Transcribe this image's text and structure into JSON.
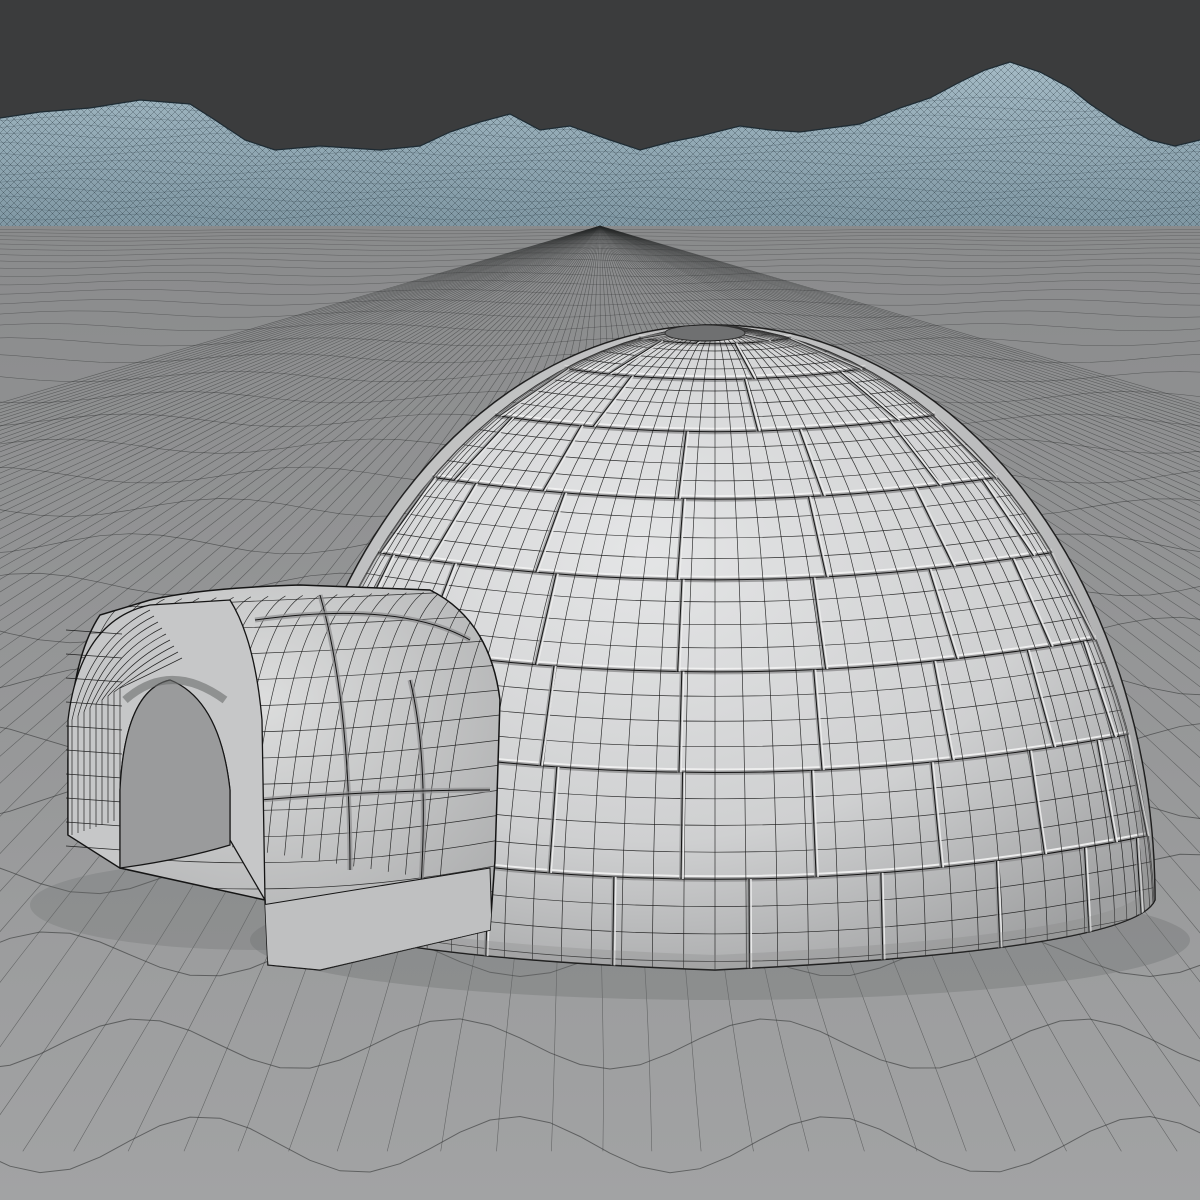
{
  "viewport": {
    "background_color": "#3b3c3d",
    "mode": "wireframe-on-shaded"
  },
  "scene": {
    "objects": [
      "mountains",
      "ground-plane",
      "igloo-dome",
      "igloo-entrance-tunnel"
    ],
    "colors": {
      "mountain_fill": "#8fa7b3",
      "mountain_fill_dark": "#6f8793",
      "mountain_wire": "#1e2b33",
      "ground_far": "#8a8b8c",
      "ground_near": "#a2a3a4",
      "ground_wire": "#2a2b2c",
      "ice_light": "#d9dadb",
      "ice_mid": "#bfc0c1",
      "ice_dark": "#8e8f90",
      "mesh_wire": "#151515"
    }
  }
}
